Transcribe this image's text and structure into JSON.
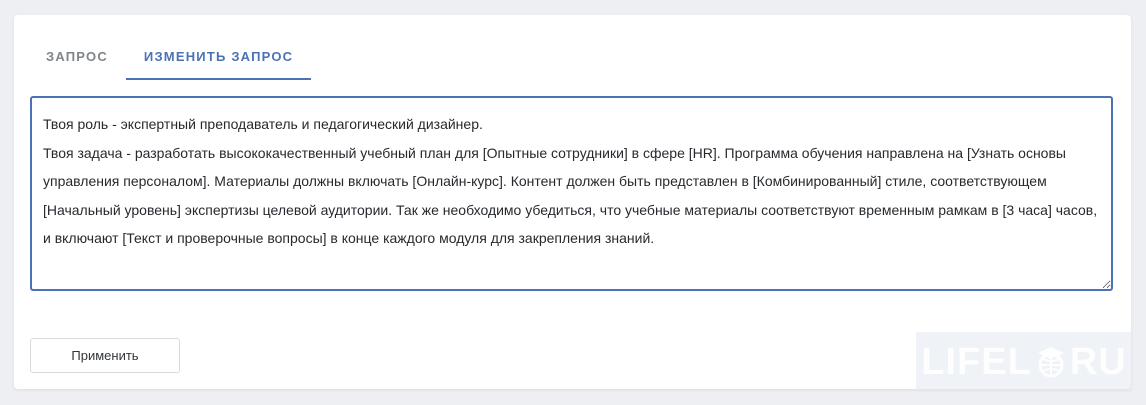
{
  "tabs": [
    {
      "label": "Запрос",
      "active": false
    },
    {
      "label": "Изменить запрос",
      "active": true
    }
  ],
  "editor": {
    "text": "Твоя роль - экспертный преподаватель и педагогический дизайнер.\nТвоя задача - разработать высококачественный учебный план для [Опытные сотрудники] в сфере [HR]. Программа обучения направлена на [Узнать основы управления персоналом]. Материалы должны включать [Онлайн-курс]. Контент должен быть представлен в [Комбинированный] стиле, соответствующем [Начальный уровень] экспертизы целевой аудитории. Так же необходимо убедиться, что учебные материалы соответствуют временным рамкам в [3 часа] часов, и включают [Текст и проверочные вопросы] в конце каждого модуля для закрепления знаний."
  },
  "apply_button": {
    "label": "Применить"
  },
  "watermark": {
    "left": "LIFEL",
    "right": "RU",
    "icon": "globe-graduation-cap-icon"
  },
  "colors": {
    "accent": "#4b72b6",
    "tab_inactive": "#7f8589",
    "text": "#262a2e"
  }
}
